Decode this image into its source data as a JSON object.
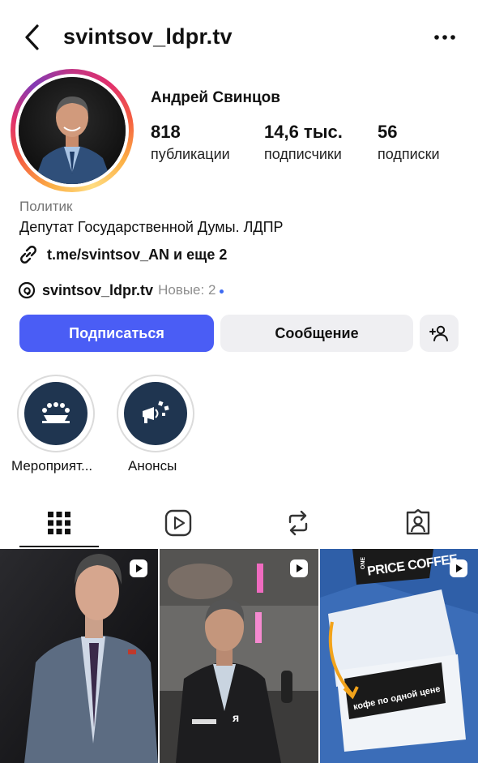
{
  "header": {
    "username": "svintsov_ldpr.tv"
  },
  "profile": {
    "full_name": "Андрей Свинцов",
    "category": "Политик",
    "bio": "Депутат Государственной Думы. ЛДПР",
    "link_text": "t.me/svintsov_AN и еще 2",
    "threads_handle": "svintsov_ldpr.tv",
    "threads_new": "Новые: 2"
  },
  "stats": [
    {
      "value": "818",
      "label": "публикации"
    },
    {
      "value": "14,6 тыс.",
      "label": "подписчики"
    },
    {
      "value": "56",
      "label": "подписки"
    }
  ],
  "buttons": {
    "follow": "Подписаться",
    "message": "Сообщение"
  },
  "highlights": [
    {
      "label": "Мероприят..."
    },
    {
      "label": "Анонсы"
    }
  ],
  "grid": {
    "post3_sign_top": "PRICE COFFEE",
    "post3_sign_top_small": "ONE",
    "post3_sign_bottom": "кофе по одной цене",
    "post2_caption": "я"
  },
  "colors": {
    "follow_button": "#4a5df5",
    "secondary_button": "#efeff2",
    "highlight_bg": "#1f3550"
  },
  "icons": [
    "back-arrow-icon",
    "more-dots-icon",
    "link-icon",
    "threads-icon",
    "add-person-icon",
    "grid-icon",
    "reels-icon",
    "repost-icon",
    "tagged-icon",
    "reel-badge-icon"
  ]
}
